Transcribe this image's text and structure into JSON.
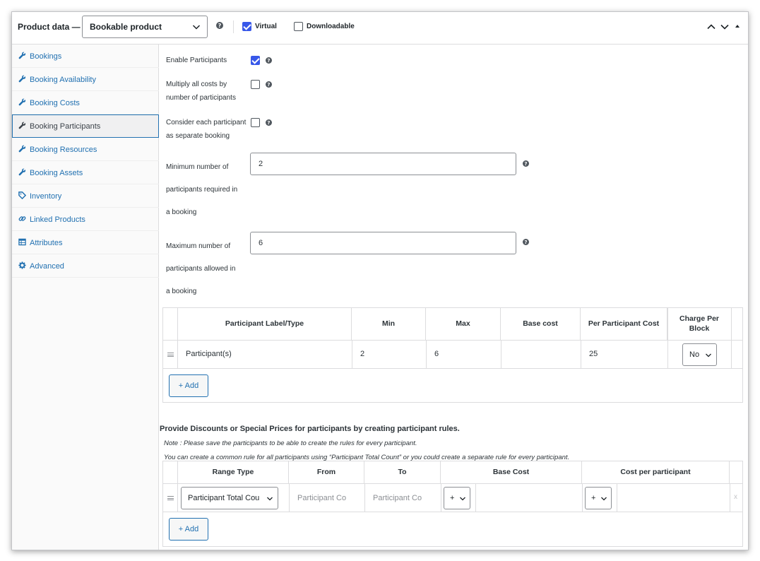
{
  "header": {
    "title": "Product data —",
    "product_type": "Bookable product",
    "virtual_label": "Virtual",
    "virtual_checked": true,
    "downloadable_label": "Downloadable",
    "downloadable_checked": false
  },
  "sidebar": {
    "items": [
      {
        "label": "Bookings",
        "icon": "wrench-icon"
      },
      {
        "label": "Booking Availability",
        "icon": "wrench-icon"
      },
      {
        "label": "Booking Costs",
        "icon": "wrench-icon"
      },
      {
        "label": "Booking Participants",
        "icon": "wrench-icon",
        "active": true
      },
      {
        "label": "Booking Resources",
        "icon": "wrench-icon"
      },
      {
        "label": "Booking Assets",
        "icon": "wrench-icon"
      },
      {
        "label": "Inventory",
        "icon": "tag-icon"
      },
      {
        "label": "Linked Products",
        "icon": "link-icon"
      },
      {
        "label": "Attributes",
        "icon": "table-icon"
      },
      {
        "label": "Advanced",
        "icon": "gear-icon"
      }
    ]
  },
  "form": {
    "enable_participants_label": "Enable Participants",
    "enable_participants_checked": true,
    "multiply_label_1": "Multiply all costs by",
    "multiply_label_2": "number of participants",
    "multiply_checked": false,
    "consider_label_1": "Consider each participant",
    "consider_label_2": "as separate booking",
    "consider_checked": false,
    "min_label_1": "Minimum number of",
    "min_label_2": "participants required in",
    "min_label_3": "a booking",
    "min_value": "2",
    "max_label_1": "Maximum number of",
    "max_label_2": "participants allowed in",
    "max_label_3": "a booking",
    "max_value": "6"
  },
  "participants_table": {
    "headers": {
      "label_type": "Participant Label/Type",
      "min": "Min",
      "max": "Max",
      "base_cost": "Base cost",
      "per_participant_cost": "Per Participant Cost",
      "charge_per_block": "Charge Per Block"
    },
    "rows": [
      {
        "label": "Participant(s)",
        "min": "2",
        "max": "6",
        "base_cost": "",
        "per_participant_cost": "25",
        "charge_per_block": "No"
      }
    ],
    "add_label": "+ Add"
  },
  "discounts": {
    "title": "Provide Discounts or Special Prices for participants by creating participant rules.",
    "note_1": "Note : Please save the participants to be able to create the rules for every participant.",
    "note_2": "You can create a common rule for all participants using “Participant Total Count” or you could create a separate rule for every participant.",
    "headers": {
      "range_type": "Range Type",
      "from": "From",
      "to": "To",
      "base_cost": "Base Cost",
      "cost_per_participant": "Cost per participant"
    },
    "rows": [
      {
        "range_type": "Participant Total Cou",
        "from_placeholder": "Participant Co",
        "to_placeholder": "Participant Co",
        "base_cost_op": "+",
        "cost_op": "+",
        "remove": "x"
      }
    ],
    "add_label": "+ Add"
  }
}
